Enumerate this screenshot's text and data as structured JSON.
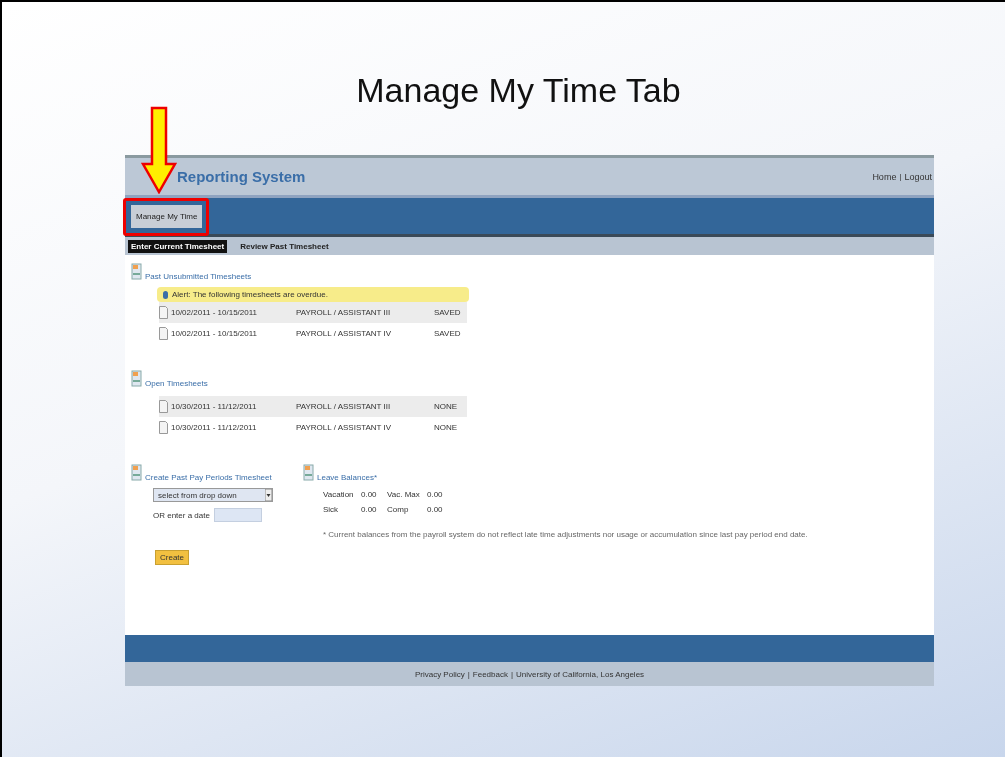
{
  "slide_title": "Manage My Time Tab",
  "app": {
    "title": "Reporting System",
    "separator": "|",
    "header_links": [
      "Home",
      "Logout"
    ],
    "nav_tabs": [
      {
        "label": "Manage My Time",
        "selected": true
      }
    ],
    "sub_tabs": [
      {
        "label": "Enter Current Timesheet",
        "selected": true
      },
      {
        "label": "Review Past Timesheet",
        "selected": false
      }
    ],
    "past_unsubmitted": {
      "heading": "Past Unsubmitted Timesheets",
      "alert": "Alert: The following timesheets are overdue.",
      "rows": [
        {
          "period": "10/02/2011 - 10/15/2011",
          "job": "PAYROLL / ASSISTANT III",
          "status": "SAVED"
        },
        {
          "period": "10/02/2011 - 10/15/2011",
          "job": "PAYROLL / ASSISTANT IV",
          "status": "SAVED"
        }
      ]
    },
    "open": {
      "heading": "Open Timesheets",
      "rows": [
        {
          "period": "10/30/2011 - 11/12/2011",
          "job": "PAYROLL / ASSISTANT III",
          "status": "NONE"
        },
        {
          "period": "10/30/2011 - 11/12/2011",
          "job": "PAYROLL / ASSISTANT IV",
          "status": "NONE"
        }
      ]
    },
    "create": {
      "heading": "Create Past Pay Periods Timesheet",
      "select": "select from drop down",
      "date_label": "OR enter a date",
      "button": "Create"
    },
    "leave": {
      "heading": "Leave Balances*",
      "rows": [
        [
          "Vacation",
          "0.00",
          "Vac. Max",
          "0.00"
        ],
        [
          "Sick",
          "0.00",
          "Comp",
          "0.00"
        ]
      ],
      "note": "* Current balances from the payroll system do not reflect late time adjustments nor usage or accumulation since last pay period end date."
    },
    "footer_links": [
      "Privacy Policy",
      "Feedback",
      "University of California, Los Angeles"
    ]
  }
}
